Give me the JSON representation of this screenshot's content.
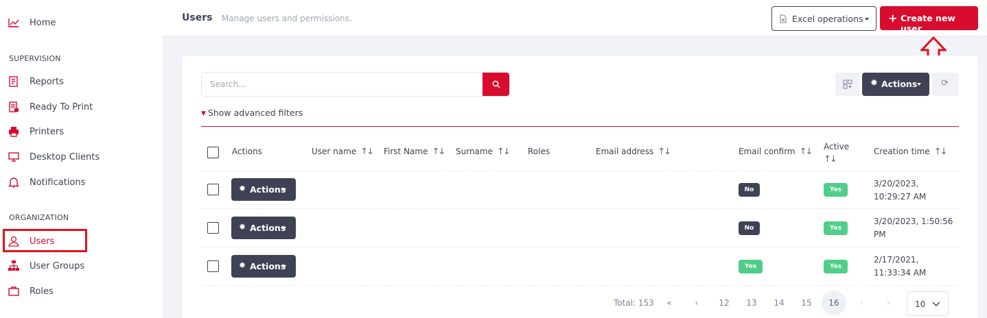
{
  "sidebar": {
    "items_top": [
      {
        "label": "Home",
        "icon": "chart-line-icon"
      }
    ],
    "supervision_heading": "SUPERVISION",
    "supervision_items": [
      {
        "label": "Reports",
        "icon": "report-icon"
      },
      {
        "label": "Ready To Print",
        "icon": "document-print-icon"
      },
      {
        "label": "Printers",
        "icon": "printer-icon"
      },
      {
        "label": "Desktop Clients",
        "icon": "monitor-icon"
      },
      {
        "label": "Notifications",
        "icon": "bell-icon"
      }
    ],
    "organization_heading": "ORGANIZATION",
    "organization_items": [
      {
        "label": "Users",
        "icon": "users-icon",
        "active": true
      },
      {
        "label": "User Groups",
        "icon": "sitemap-icon"
      },
      {
        "label": "Roles",
        "icon": "briefcase-icon"
      }
    ]
  },
  "header": {
    "title": "Users",
    "subtitle": "Manage users and permissions.",
    "excel_label": "Excel operations",
    "create_label": "Create new user"
  },
  "toolbar": {
    "search_placeholder": "Search...",
    "advanced_filters_label": "Show advanced filters",
    "actions_label": "Actions"
  },
  "table": {
    "columns": [
      "Actions",
      "User name",
      "First Name",
      "Surname",
      "Roles",
      "Email address",
      "Email confirm",
      "Active",
      "Creation time"
    ],
    "rows": [
      {
        "actions_label": "Actions",
        "user_name": "",
        "first_name": "",
        "surname": "",
        "roles": "",
        "email": "",
        "email_confirm": "No",
        "active": "Yes",
        "creation_time": "3/20/2023, 10:29:27 AM"
      },
      {
        "actions_label": "Actions",
        "user_name": "",
        "first_name": "",
        "surname": "",
        "roles": "",
        "email": "",
        "email_confirm": "No",
        "active": "Yes",
        "creation_time": "3/20/2023, 1:50:56 PM"
      },
      {
        "actions_label": "Actions",
        "user_name": "",
        "first_name": "",
        "surname": "",
        "roles": "",
        "email": "",
        "email_confirm": "Yes",
        "active": "Yes",
        "creation_time": "2/17/2021, 11:33:34 AM"
      }
    ]
  },
  "pagination": {
    "total_label": "Total: 153",
    "first": "«",
    "prev": "‹",
    "pages": [
      "12",
      "13",
      "14",
      "15",
      "16"
    ],
    "current_page": "16",
    "next": "›",
    "last": "»",
    "page_size": "10"
  },
  "colors": {
    "brand_red": "#d70c2e",
    "dark": "#3f4254",
    "success": "#50cd89",
    "highlight_annotation": "#e3101e"
  }
}
